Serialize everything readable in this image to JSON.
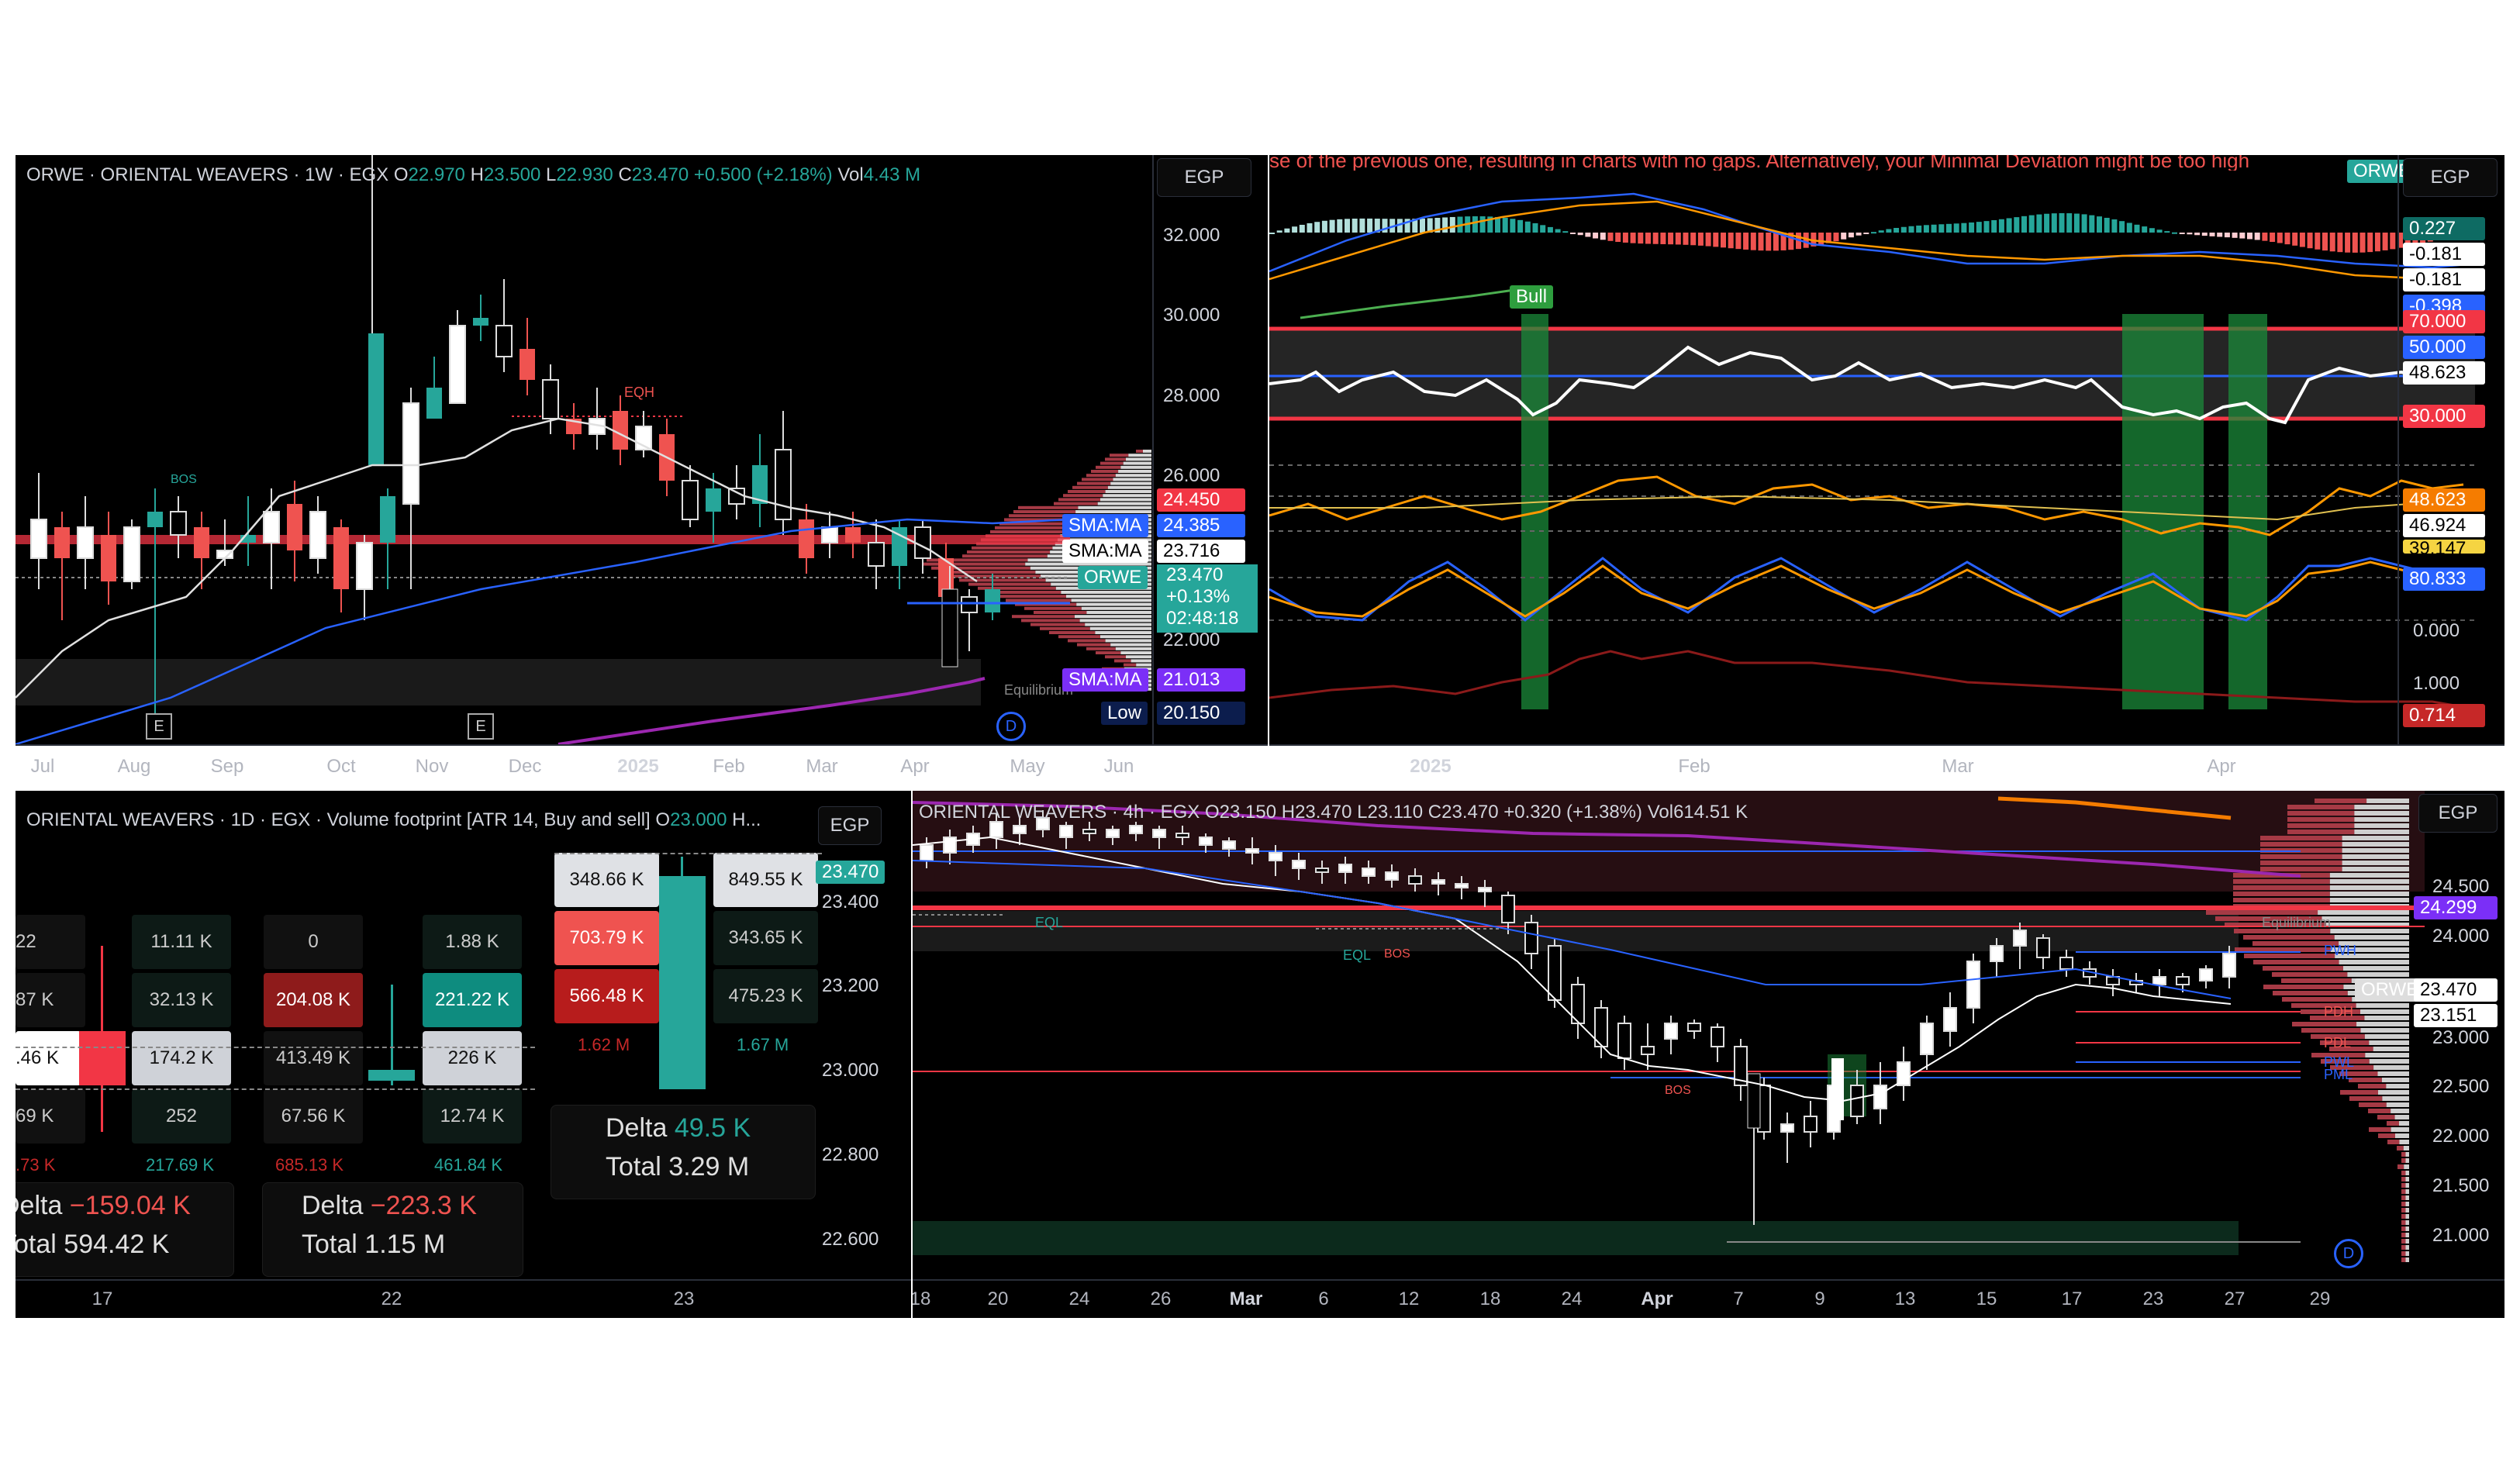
{
  "weekly": {
    "title": "ORWE · ORIENTAL WEAVERS · 1W · EGX",
    "o_label": "O",
    "o": "22.970",
    "h_label": "H",
    "h": "23.500",
    "l_label": "L",
    "l": "22.930",
    "c_label": "C",
    "c": "23.470",
    "change": "+0.500 (+2.18%)",
    "vol_label": "Vol",
    "vol": "4.43 M",
    "currency": "EGP",
    "price_levels": [
      "32.000",
      "30.000",
      "28.000",
      "26.000",
      "22.000"
    ],
    "tags": {
      "red_level": "24.450",
      "sma1_name": "SMA:MA",
      "sma1": "24.385",
      "sma2_name": "SMA:MA",
      "sma2": "23.716",
      "ticker": "ORWE",
      "last": "23.470",
      "pct": "+0.13%",
      "countdown": "02:48:18",
      "sma3_name": "SMA:MA",
      "sma3": "21.013",
      "low_name": "Low",
      "low": "20.150"
    },
    "annotations": {
      "eqh": "EQH",
      "bos": "BOS",
      "equilibrium": "Equilibrium",
      "e": "E",
      "d": "D"
    },
    "x_labels": [
      "Jul",
      "Aug",
      "Sep",
      "Oct",
      "Nov",
      "Dec",
      "2025",
      "Feb",
      "Mar",
      "Apr",
      "May",
      "Jun"
    ]
  },
  "oscillator": {
    "banner": "se of the previous one, resulting in charts with no gaps. Alternatively, your Minimal Deviation might be too high",
    "symbol_tag": "ORWE",
    "currency": "EGP",
    "bull_label": "Bull",
    "tags": {
      "t1": "0.227",
      "t2": "-0.181",
      "t3": "-0.181",
      "t4": "-0.398",
      "rsi_top": "70.000",
      "rsi_mid": "50.000",
      "rsi_val": "48.623",
      "rsi_low": "30.000",
      "o1": "48.623",
      "o2": "46.924",
      "o3": "39.147",
      "s1": "80.833",
      "zero": "0.000",
      "one": "1.000",
      "last": "0.714"
    },
    "x_labels": [
      "2025",
      "Feb",
      "Mar",
      "Apr"
    ]
  },
  "footprint": {
    "title": "ORIENTAL WEAVERS · 1D · EGX · Volume footprint [ATR 14, Buy and sell]",
    "o_label": "O",
    "o": "23.000",
    "trail": "H...",
    "currency": "EGP",
    "price_tag": "23.470",
    "price_levels": [
      "23.400",
      "23.200",
      "23.000",
      "22.800",
      "22.600"
    ],
    "col1": {
      "sell": [
        "22",
        "87 K",
        ".46 K",
        "69 K"
      ],
      "buy": [
        "11.11 K",
        "32.13 K",
        "174.2 K",
        "252"
      ],
      "sell_total": ".73 K",
      "buy_total": "217.69 K",
      "delta_label": "Delta",
      "delta": "−159.04 K",
      "total_label": "Total",
      "total": "594.42 K"
    },
    "col2": {
      "sell": [
        "0",
        "204.08 K",
        "413.49 K",
        "67.56 K"
      ],
      "buy": [
        "1.88 K",
        "221.22 K",
        "226 K",
        "12.74 K"
      ],
      "sell_total": "685.13 K",
      "buy_total": "461.84 K",
      "delta_label": "Delta",
      "delta": "−223.3 K",
      "total_label": "Total",
      "total": "1.15 M"
    },
    "col3": {
      "sell": [
        "348.66 K",
        "703.79 K",
        "566.48 K"
      ],
      "buy": [
        "849.55 K",
        "343.65 K",
        "475.23 K"
      ],
      "sell_total": "1.62 M",
      "buy_total": "1.67 M",
      "delta_label": "Delta",
      "delta": "49.5 K",
      "total_label": "Total",
      "total": "3.29 M"
    },
    "x_labels": [
      "17",
      "22",
      "23"
    ]
  },
  "h4": {
    "title": "ORIENTAL WEAVERS · 4h · EGX",
    "o_label": "O",
    "o": "23.150",
    "h_label": "H",
    "h": "23.470",
    "l_label": "L",
    "l": "23.110",
    "c_label": "C",
    "c": "23.470",
    "change": "+0.320 (+1.38%)",
    "vol_label": "Vol",
    "vol": "614.51 K",
    "currency": "EGP",
    "price_levels": [
      "24.500",
      "24.000",
      "22.500",
      "22.000",
      "21.500",
      "21.000"
    ],
    "extra_level": "23.000",
    "tags": {
      "red": "24.299",
      "ticker": "ORWE",
      "last": "23.470",
      "ref": "23.151"
    },
    "annotations": {
      "eql": "EQL",
      "eql2": "EQL",
      "bos": "BOS",
      "bos2": "BOS",
      "equilibrium": "Equilibrium",
      "pwh": "PWH",
      "pdh": "PDH",
      "pdl": "PDL",
      "pwl": "PWL",
      "pml": "PML",
      "d": "D"
    },
    "x_labels": [
      "18",
      "20",
      "24",
      "26",
      "Mar",
      "6",
      "12",
      "18",
      "24",
      "Apr",
      "7",
      "9",
      "13",
      "15",
      "17",
      "23",
      "27",
      "29"
    ]
  },
  "colors": {
    "up": "#26a69a",
    "down": "#ef5350",
    "rsi": "#ffffff",
    "sma_blue": "#2962ff",
    "sma_purple": "#7e57c2"
  }
}
